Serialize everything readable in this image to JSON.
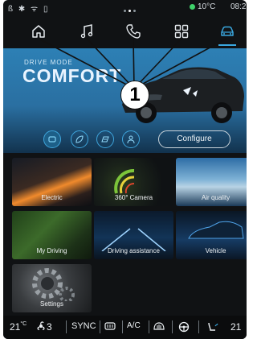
{
  "status_bar": {
    "left_icons": "ß ✱ ᯤ ▯",
    "temperature": "10°C",
    "time": "08:2"
  },
  "nav": {
    "items": [
      "home-icon",
      "music-icon",
      "phone-icon",
      "apps-icon",
      "car-icon"
    ],
    "active": "car-icon"
  },
  "hero": {
    "mode_label": "DRIVE MODE",
    "mode_value": "COMFORT"
  },
  "callout": {
    "label": "1"
  },
  "modes": {
    "configure_label": "Configure"
  },
  "tiles": [
    {
      "label": "Electric"
    },
    {
      "label": "360° Camera"
    },
    {
      "label": "Air quality"
    },
    {
      "label": "My Driving"
    },
    {
      "label": "Driving assistance"
    },
    {
      "label": "Vehicle"
    },
    {
      "label": "Settings"
    }
  ],
  "bottom_bar": {
    "left_temp": "21",
    "left_temp_unit": "°C",
    "fan_speed": "3",
    "sync_label": "SYNC",
    "ac_label": "A/C",
    "right_temp": "21"
  }
}
